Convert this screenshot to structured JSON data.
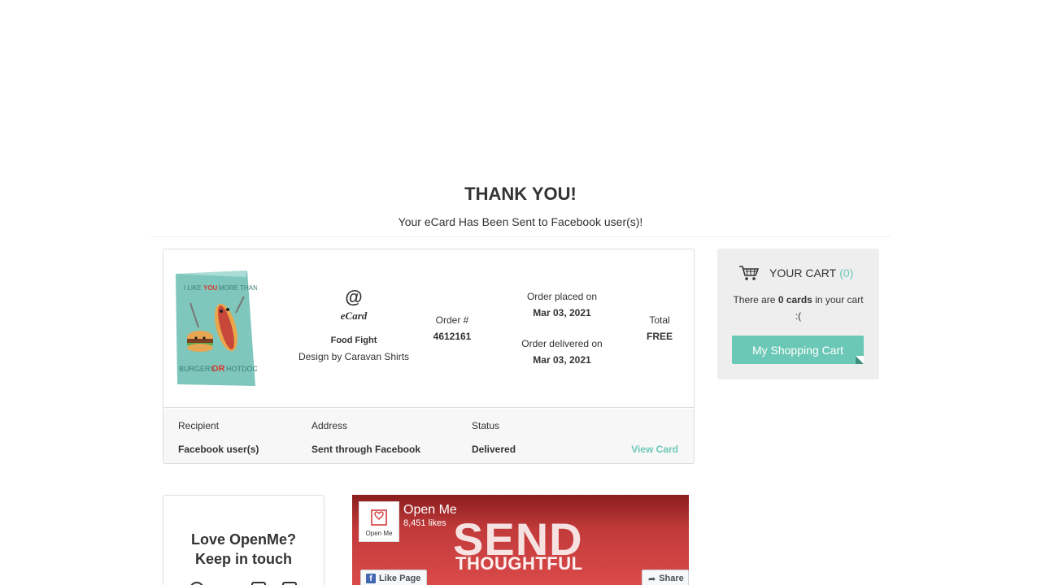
{
  "header": {
    "title": "THANK YOU!",
    "subtitle": "Your eCard Has Been Sent to Facebook user(s)!"
  },
  "order": {
    "card_image_alt": "Food Fight card: I LIKE YOU MORE THAN BURGERS OR HOTDOGS",
    "type_symbol": "@",
    "type_label": "eCard",
    "card_name": "Food Fight",
    "designer": "Design by Caravan Shirts",
    "order_number_label": "Order #",
    "order_number": "4612161",
    "placed_label": "Order placed on",
    "placed_date": "Mar 03, 2021",
    "delivered_label": "Order delivered on",
    "delivered_date": "Mar 03, 2021",
    "total_label": "Total",
    "total_value": "FREE"
  },
  "order_meta": {
    "recipient_label": "Recipient",
    "recipient_value": "Facebook user(s)",
    "address_label": "Address",
    "address_value": "Sent through Facebook",
    "status_label": "Status",
    "status_value": "Delivered",
    "view_card_link": "View Card"
  },
  "cart": {
    "title": "YOUR CART",
    "count": "(0)",
    "text_before": "There are",
    "text_bold": "0 cards",
    "text_after": "in your cart",
    "text_emoticon": ":(",
    "button_label": "My Shopping Cart",
    "icon": "cart-icon"
  },
  "social": {
    "title_line1": "Love OpenMe?",
    "title_line2": "Keep in touch"
  },
  "facebook": {
    "page_name": "Open Me",
    "likes": "8,451 likes",
    "cover_line1": "SEND",
    "cover_line2": "THOUGHTFUL",
    "logo_text": "Open Me",
    "like_button": "Like Page",
    "share_button": "Share"
  },
  "colors": {
    "accent": "#6cc8b6",
    "panel_bg": "#eeeeee",
    "facebook_blue": "#4267b2"
  }
}
